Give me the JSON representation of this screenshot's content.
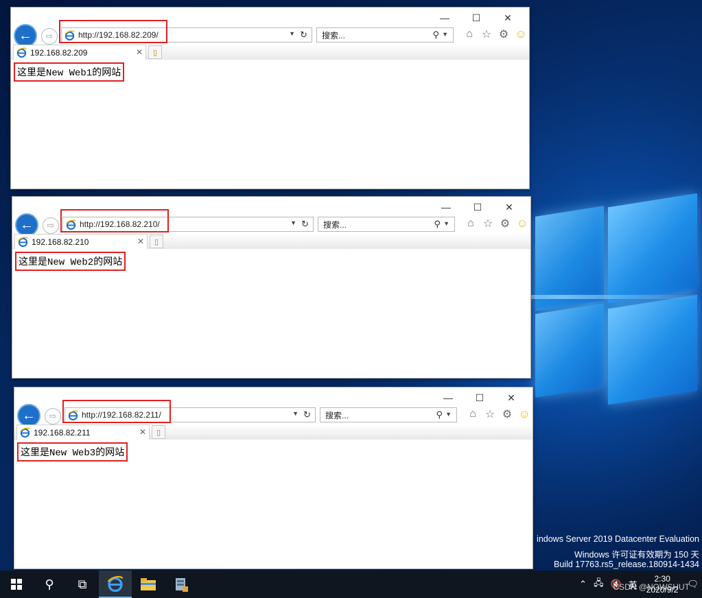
{
  "desktop": {
    "watermark": {
      "line1": "indows Server 2019 Datacenter Evaluation",
      "line2": "Windows 许可证有效期为 150 天",
      "line3": "Build 17763.rs5_release.180914-1434"
    }
  },
  "windows": [
    {
      "address": "http://192.168.82.209/",
      "search_placeholder": "搜索...",
      "tab_title": "192.168.82.209",
      "content_prefix": "这里是",
      "content_mono": "New Web1",
      "content_suffix": "的网站"
    },
    {
      "address": "http://192.168.82.210/",
      "search_placeholder": "搜索...",
      "tab_title": "192.168.82.210",
      "content_prefix": "这里是",
      "content_mono": "New Web2",
      "content_suffix": "的网站"
    },
    {
      "address": "http://192.168.82.211/",
      "search_placeholder": "搜索...",
      "tab_title": "192.168.82.211",
      "content_prefix": "这里是",
      "content_mono": "New Web3",
      "content_suffix": "的网站"
    }
  ],
  "taskbar": {
    "tray": {
      "language": "英",
      "time": "2:30",
      "date": "2020/9/2",
      "watermark_overlay": "CSDN @NOWSHUT"
    }
  },
  "colors": {
    "highlight_box": "#e02020",
    "ie_blue": "#1e6fc8",
    "taskbar": "#0f1620"
  },
  "icons": {
    "back": "back-arrow-icon",
    "forward": "forward-arrow-icon",
    "refresh": "refresh-icon",
    "search": "search-icon",
    "home": "home-icon",
    "favorites": "star-icon",
    "settings": "gear-icon",
    "feedback": "smiley-icon",
    "start": "windows-start-icon"
  }
}
